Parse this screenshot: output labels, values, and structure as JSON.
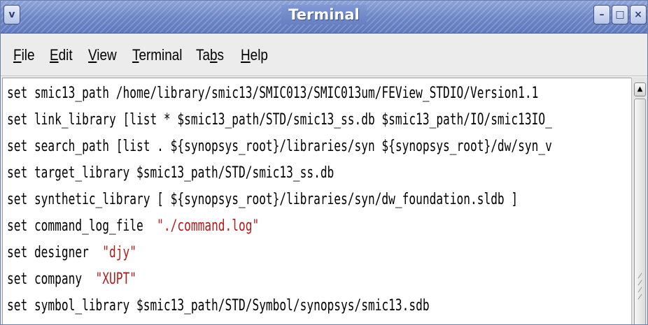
{
  "window": {
    "title": "Terminal",
    "menu_button_glyph": "v",
    "minimize_glyph": "–",
    "maximize_glyph": "□",
    "close_glyph": "×"
  },
  "menubar": {
    "items": [
      {
        "mnemonic": "F",
        "rest": "ile"
      },
      {
        "mnemonic": "E",
        "rest": "dit"
      },
      {
        "mnemonic": "V",
        "rest": "iew"
      },
      {
        "mnemonic": "T",
        "rest": "erminal"
      },
      {
        "pre": "Ta",
        "mnemonic": "b",
        "rest": "s"
      },
      {
        "mnemonic": "H",
        "rest": "elp"
      }
    ]
  },
  "terminal": {
    "lines": [
      {
        "text": "set smic13_path /home/library/smic13/SMIC013/SMIC013um/FEView_STDIO/Version1.1",
        "string": ""
      },
      {
        "text": "set link_library [list * $smic13_path/STD/smic13_ss.db $smic13_path/IO/smic13IO_",
        "string": ""
      },
      {
        "text": "set search_path [list . ${synopsys_root}/libraries/syn ${synopsys_root}/dw/syn_v",
        "string": ""
      },
      {
        "text": "set target_library $smic13_path/STD/smic13_ss.db",
        "string": ""
      },
      {
        "text": "set synthetic_library [ ${synopsys_root}/libraries/syn/dw_foundation.sldb ]",
        "string": ""
      },
      {
        "text": "set command_log_file  ",
        "string": "\"./command.log\""
      },
      {
        "text": "set designer  ",
        "string": "\"djy\""
      },
      {
        "text": "set company  ",
        "string": "\"XUPT\""
      },
      {
        "text": "set symbol_library $smic13_path/STD/Symbol/synopsys/smic13.sdb",
        "string": ""
      }
    ]
  },
  "scrollbar": {
    "up_arrow_icon": "arrow-up-icon",
    "up_glyph": "▲"
  },
  "colors": {
    "titlebar": "#6d86c6",
    "string_literal": "#b01c1c",
    "text": "#000000"
  }
}
